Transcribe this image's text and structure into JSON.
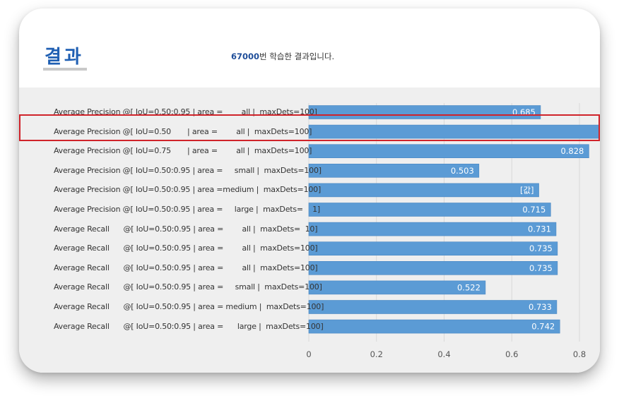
{
  "header": {
    "title": "결과",
    "subtitle_number": "67000",
    "subtitle_text": "번 학습한 결과입니다."
  },
  "chart_data": {
    "type": "bar",
    "orientation": "horizontal",
    "categories": [
      "Average Precision @[ IoU=0.50:0.95 | area =        all |  maxDets=100]",
      "Average Precision @[ IoU=0.50       | area =        all |  maxDets=100]",
      "Average Precision @[ IoU=0.75       | area =        all |  maxDets=100]",
      "Average Precision @[ IoU=0.50:0.95 | area =     small |  maxDets=100]",
      "Average Precision @[ IoU=0.50:0.95 | area =medium |  maxDets=100]",
      "Average Precision @[ IoU=0.50:0.95 | area =     large |  maxDets=    1]",
      "Average Recall      @[ IoU=0.50:0.95 | area =        all |  maxDets=  10]",
      "Average Recall      @[ IoU=0.50:0.95 | area =        all |  maxDets=100]",
      "Average Recall      @[ IoU=0.50:0.95 | area =        all |  maxDets=100]",
      "Average Recall      @[ IoU=0.50:0.95 | area =     small |  maxDets=100]",
      "Average Recall      @[ IoU=0.50:0.95 | area = medium |  maxDets=100]",
      "Average Recall      @[ IoU=0.50:0.95 | area =      large |  maxDets=100]"
    ],
    "values": [
      0.685,
      0.9,
      0.828,
      0.503,
      0.68,
      0.715,
      0.731,
      0.735,
      0.735,
      0.522,
      0.733,
      0.742
    ],
    "value_labels": [
      "0.685",
      "",
      "0.828",
      "0.503",
      "[값]",
      "0.715",
      "0.731",
      "0.735",
      "0.735",
      "0.522",
      "0.733",
      "0.742"
    ],
    "xlim": [
      0,
      0.8
    ],
    "xticks": [
      "0",
      "0.2",
      "0.4",
      "0.6",
      "0.8"
    ],
    "grid": true,
    "highlighted_index": 1,
    "bar_color": "#5b9bd5",
    "highlight_color": "#d0232a"
  }
}
